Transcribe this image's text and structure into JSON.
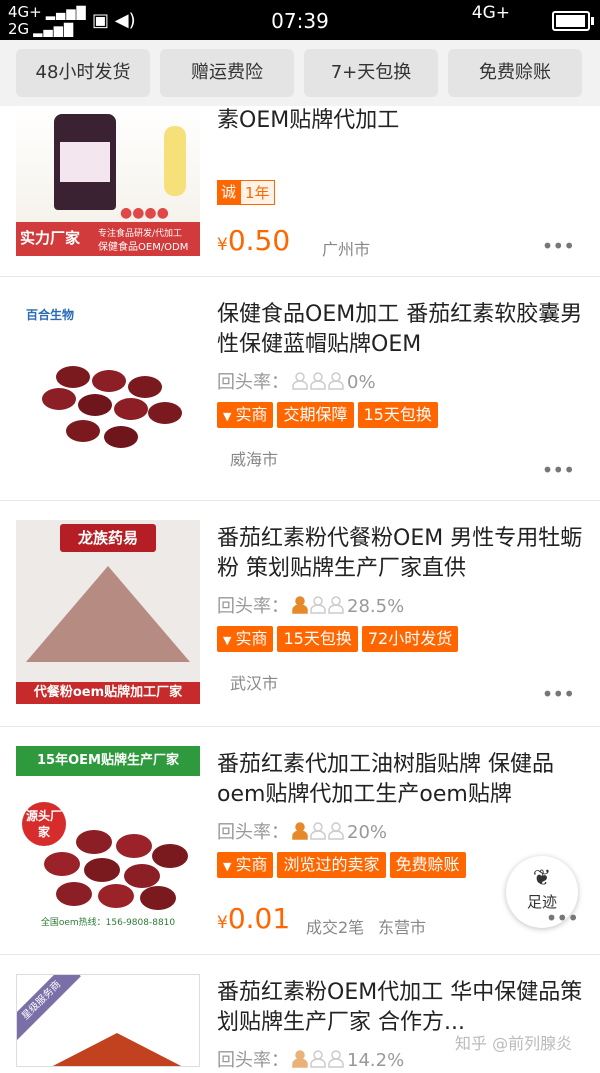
{
  "status": {
    "left_top": "4G+",
    "left_bottom": "2G",
    "time": "07:39",
    "right": "4G+",
    "battery_level": 0.95
  },
  "filters": [
    "48小时发货",
    "赠运费险",
    "7+天包换",
    "免费赊账"
  ],
  "items": [
    {
      "title": "素OEM贴牌代加工",
      "badge_year": "诚",
      "badge_year_text": "1年",
      "price_symbol": "¥",
      "price": "0.50",
      "city": "广州市",
      "thumb_caption_left": "实力厂家",
      "thumb_caption_right": "专注食品研发/代加工",
      "thumb_caption_bottom": "保健食品OEM/ODM"
    },
    {
      "title": "保健食品OEM加工 番茄红素软胶囊男性保健蓝帽贴牌OEM",
      "rate_label": "回头率：",
      "rate_value": "0%",
      "tags": [
        "实商",
        "交期保障",
        "15天包换"
      ],
      "city": "威海市",
      "brand": "百合生物"
    },
    {
      "title": "番茄红素粉代餐粉OEM  男性专用牡蛎粉  策划贴牌生产厂家直供",
      "rate_label": "回头率：",
      "rate_value": "28.5%",
      "tags": [
        "实商",
        "15天包换",
        "72小时发货"
      ],
      "city": "武汉市",
      "brand": "龙族药易",
      "caption": "代餐粉oem贴牌加工厂家"
    },
    {
      "title": "番茄红素代加工油树脂贴牌 保健品oem贴牌代加工生产oem贴牌",
      "rate_label": "回头率：",
      "rate_value": "20%",
      "tags": [
        "实商",
        "浏览过的卖家",
        "免费赊账"
      ],
      "price_symbol": "¥",
      "price": "0.01",
      "sales": "成交2笔",
      "city": "东营市",
      "banner": "15年OEM贴牌生产厂家",
      "seal": "源头厂家",
      "hotline": "全国oem热线：156-9808-8810"
    },
    {
      "title": "番茄红素粉OEM代加工  华中保健品策划贴牌生产厂家 合作方...",
      "rate_label": "回头率：",
      "rate_value": "14.2%",
      "ribbon": "星级服务商"
    }
  ],
  "fab": {
    "label": "足迹"
  },
  "watermark": "知乎 @前列腺炎",
  "colors": {
    "accent": "#ff6600"
  }
}
